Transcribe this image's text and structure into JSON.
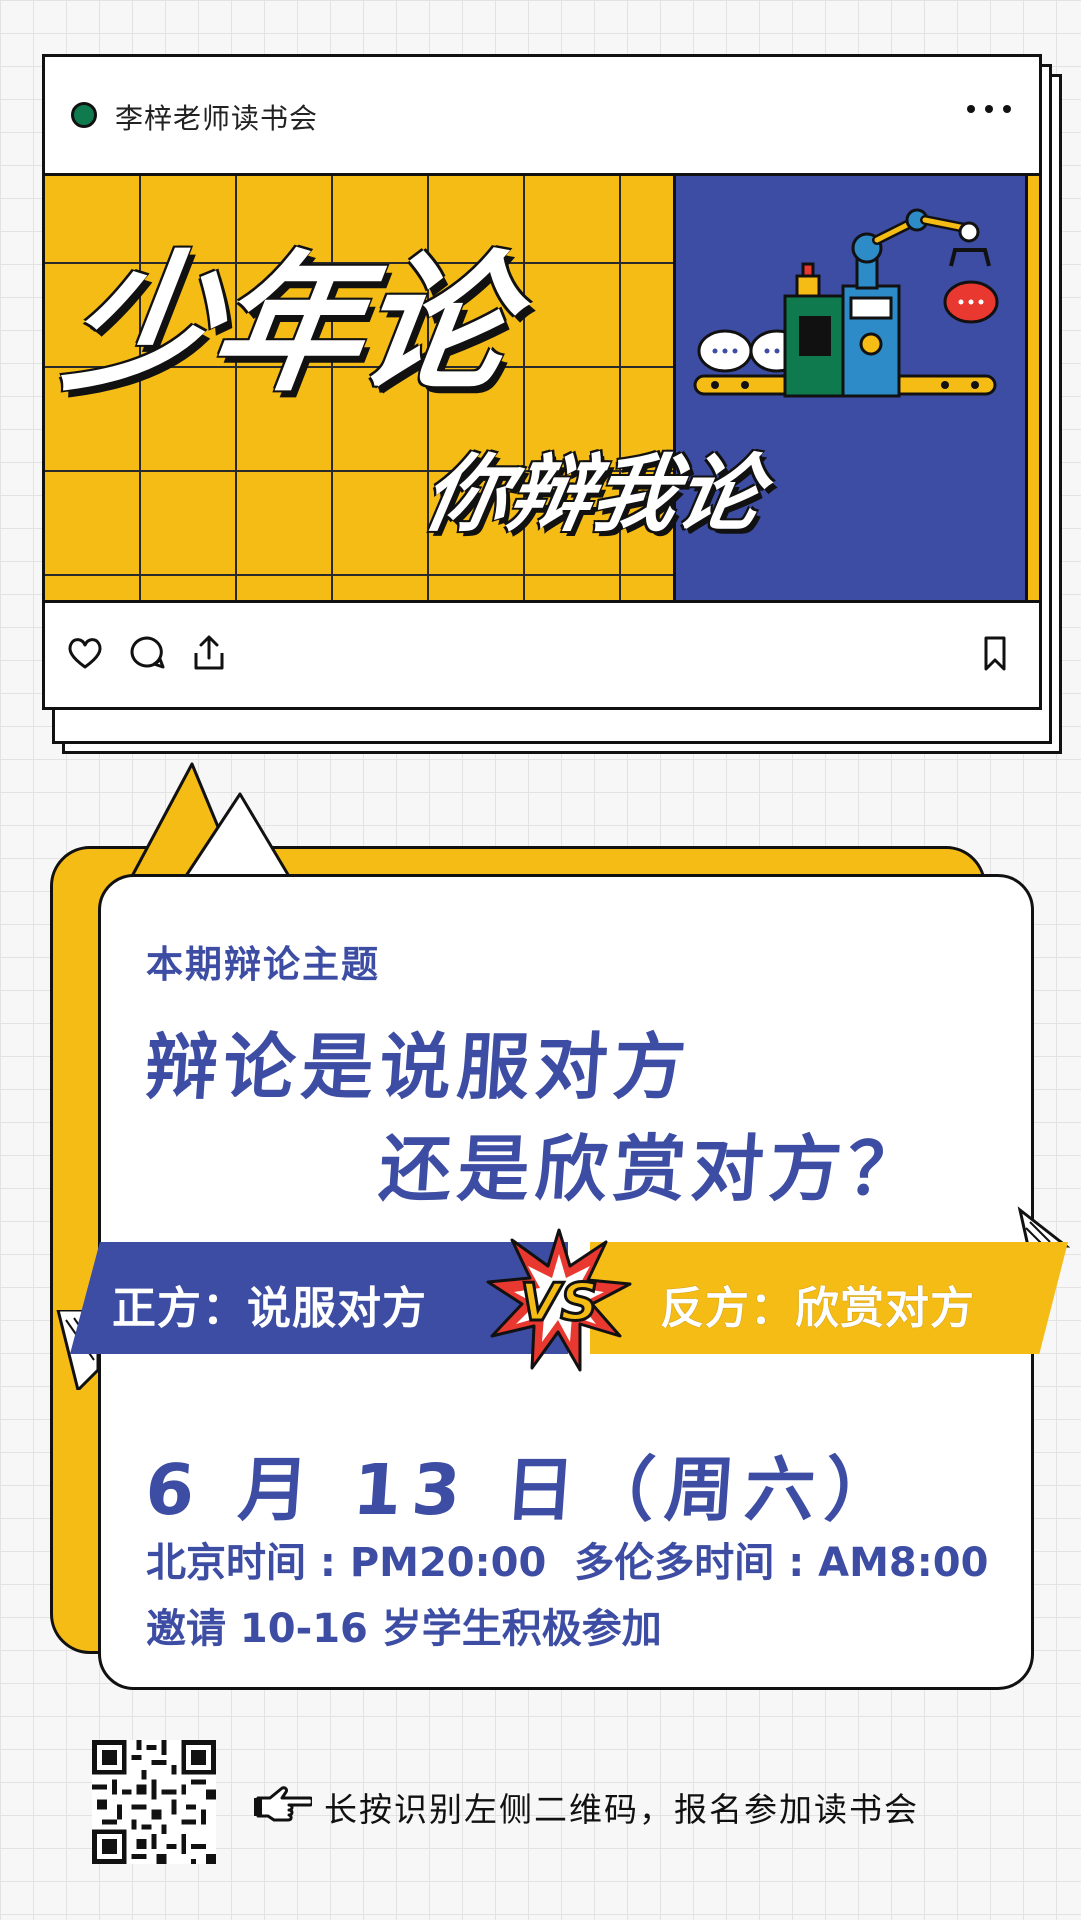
{
  "post": {
    "account_name": "李梓老师读书会",
    "banner_title": "少年论",
    "banner_subtitle": "你辩我论",
    "icons": [
      "heart-icon",
      "comment-icon",
      "share-icon",
      "bookmark-icon",
      "more-icon"
    ]
  },
  "topic": {
    "label": "本期辩论主题",
    "line1": "辩论是说服对方",
    "line2": "还是欣赏对方？",
    "pro": "正方：说服对方",
    "vs": "VS",
    "con": "反方：欣赏对方",
    "date": "6 月 13 日（周六）",
    "beijing_time": "北京时间 : PM20:00",
    "toronto_time": "多伦多时间 : AM8:00",
    "invite": "邀请 10-16 岁学生积极参加"
  },
  "footer": {
    "text": "长按识别左侧二维码，报名参加读书会"
  },
  "colors": {
    "blue": "#3d4da3",
    "yellow": "#f6bc16",
    "red": "#e8382f",
    "green": "#0f7a4e"
  }
}
